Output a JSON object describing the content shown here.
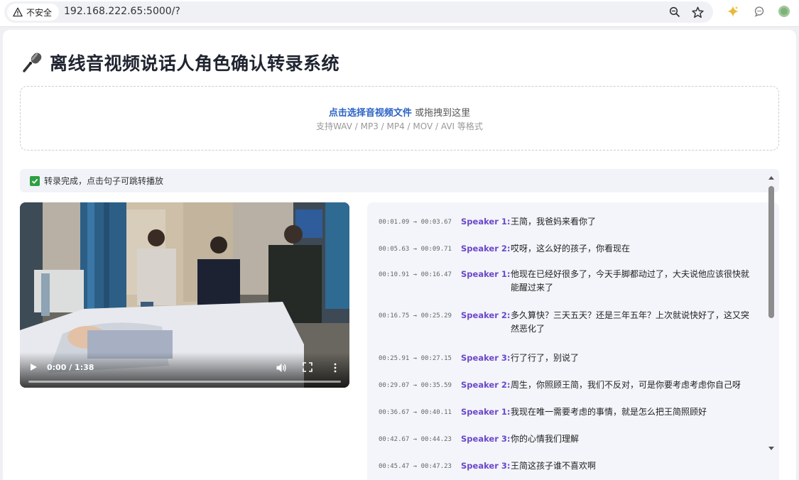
{
  "browser": {
    "security_label": "不安全",
    "url": "192.168.222.65:5000/?",
    "icons": [
      "warning-icon",
      "zoom-icon",
      "bookmark-star-icon",
      "gemini-sparkle-icon",
      "chat-icon",
      "profile-avatar"
    ]
  },
  "page": {
    "title": "离线音视频说话人角色确认转录系统",
    "title_icon": "microphone-icon"
  },
  "upload": {
    "link_text": "点击选择音视频文件",
    "drag_text": " 或拖拽到这里",
    "formats_text": "支持WAV / MP3 / MP4 / MOV / AVI 等格式"
  },
  "status": {
    "icon": "check-icon",
    "text": "转录完成，点击句子可跳转播放"
  },
  "video": {
    "time_label": "0:00 / 1:38",
    "progress": 0
  },
  "transcript": [
    {
      "time": "00:01.09 → 00:03.67",
      "speaker": "Speaker 1:",
      "text": "王简，我爸妈来看你了"
    },
    {
      "time": "00:05.63 → 00:09.71",
      "speaker": "Speaker 2:",
      "text": "哎呀，这么好的孩子，你看现在"
    },
    {
      "time": "00:10.91 → 00:16.47",
      "speaker": "Speaker 1:",
      "text": "他现在已经好很多了，今天手脚都动过了，大夫说他应该很快就能醒过来了"
    },
    {
      "time": "00:16.75 → 00:25.29",
      "speaker": "Speaker 2:",
      "text": "多久算快？三天五天？还是三年五年？上次就说快好了，这又突然恶化了"
    },
    {
      "time": "00:25.91 → 00:27.15",
      "speaker": "Speaker 3:",
      "text": "行了行了，别说了"
    },
    {
      "time": "00:29.07 → 00:35.59",
      "speaker": "Speaker 2:",
      "text": "周生，你照顾王简，我们不反对，可是你要考虑考虑你自己呀"
    },
    {
      "time": "00:36.67 → 00:40.11",
      "speaker": "Speaker 1:",
      "text": "我现在唯一需要考虑的事情，就是怎么把王简照顾好"
    },
    {
      "time": "00:42.67 → 00:44.23",
      "speaker": "Speaker 3:",
      "text": "你的心情我们理解"
    },
    {
      "time": "00:45.47 → 00:47.23",
      "speaker": "Speaker 3:",
      "text": "王简这孩子谁不喜欢啊"
    }
  ]
}
